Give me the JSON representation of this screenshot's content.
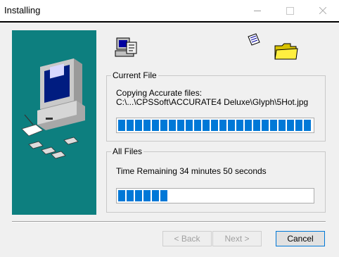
{
  "window": {
    "title": "Installing"
  },
  "current_file": {
    "group_label": "Current File",
    "line1": "Copying Accurate files:",
    "line2": "C:\\...\\CPSSoft\\ACCURATE4 Deluxe\\Glyph\\5Hot.jpg",
    "progress_fraction": 1.0
  },
  "all_files": {
    "group_label": "All Files",
    "time_remaining": "Time Remaining 34 minutes 50 seconds",
    "progress_fraction": 0.27
  },
  "buttons": {
    "back": "< Back",
    "next": "Next >",
    "cancel": "Cancel"
  },
  "colors": {
    "banner": "#0d7f7f",
    "progress": "#0078d7"
  },
  "icons": {
    "header_left": "setup-computer-icon",
    "header_doc": "document-icon",
    "header_folder": "folder-icon"
  }
}
